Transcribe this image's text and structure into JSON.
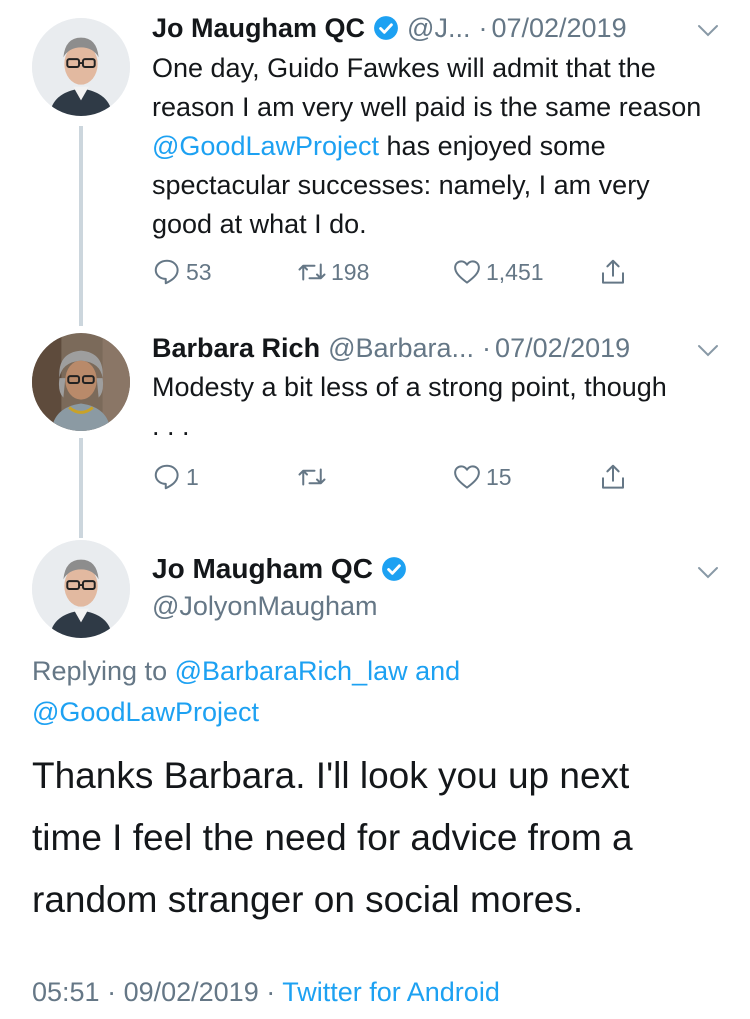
{
  "tweets": [
    {
      "name": "Jo Maugham QC",
      "verified": true,
      "handle": "@J...",
      "separator": "·",
      "date": "07/02/2019",
      "text_before": "One day, Guido Fawkes will admit that the reason I am very well paid is the same reason ",
      "mention": "@GoodLawProject",
      "text_after": " has enjoyed some spectacular successes: namely, I am very good at what I do.",
      "replies": "53",
      "retweets": "198",
      "likes": "1,451"
    },
    {
      "name": "Barbara Rich",
      "handle": "@Barbara...",
      "separator": "·",
      "date": "07/02/2019",
      "text": "Modesty a bit less of a strong point, though . . .",
      "replies": "1",
      "retweets": "",
      "likes": "15"
    }
  ],
  "main_tweet": {
    "name": "Jo Maugham QC",
    "verified": true,
    "handle": "@JolyonMaugham",
    "replying_prefix": "Replying to ",
    "replying_to_1": "@BarbaraRich_law",
    "replying_and": " and",
    "replying_to_2": "@GoodLawProject",
    "text": "Thanks Barbara. I'll look you up next time I feel the need for advice from a random stranger on social mores.",
    "time": "05:51",
    "separator1": " · ",
    "date": "09/02/2019",
    "separator2": " · ",
    "source": "Twitter for Android"
  },
  "icons": {
    "reply": "reply-icon",
    "retweet": "retweet-icon",
    "like": "heart-icon",
    "share": "share-icon",
    "verified": "verified-badge-icon",
    "menu": "chevron-down-icon"
  },
  "colors": {
    "link": "#1da1f2",
    "muted": "#657786",
    "text": "#14171a",
    "thread_line": "#ccd6dd"
  }
}
